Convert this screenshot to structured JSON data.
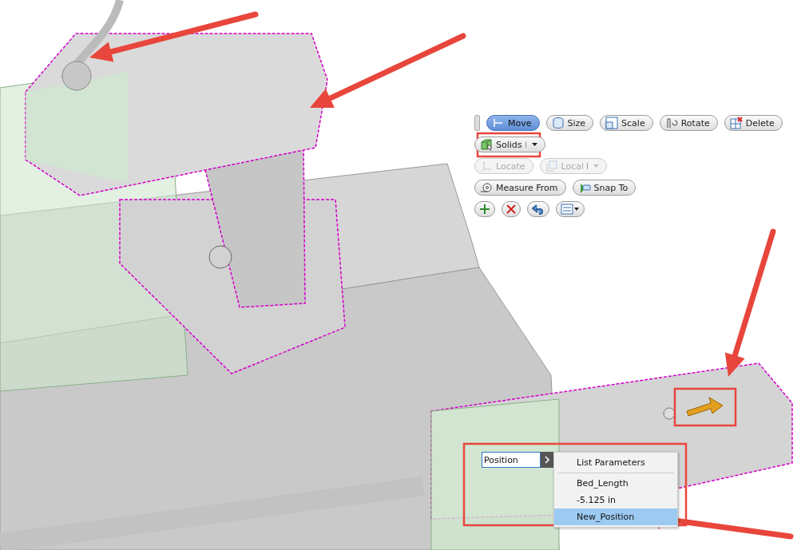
{
  "toolbar": {
    "rows": [
      {
        "buttons": [
          {
            "label": "Move",
            "selected": true,
            "disabled": false
          },
          {
            "label": "Size",
            "selected": false,
            "disabled": false
          },
          {
            "label": "Scale",
            "selected": false,
            "disabled": false
          },
          {
            "label": "Rotate",
            "selected": false,
            "disabled": false
          },
          {
            "label": "Delete",
            "selected": false,
            "disabled": false
          }
        ]
      },
      {
        "buttons": [
          {
            "label": "Solids",
            "selected": false,
            "disabled": false
          }
        ]
      },
      {
        "buttons": [
          {
            "label": "Locate",
            "selected": false,
            "disabled": true
          },
          {
            "label": "Local",
            "selected": false,
            "disabled": true
          }
        ]
      },
      {
        "buttons": [
          {
            "label": "Measure From",
            "selected": false,
            "disabled": false
          },
          {
            "label": "Snap To",
            "selected": false,
            "disabled": false
          }
        ]
      }
    ]
  },
  "value_input": {
    "value": "Position"
  },
  "parameter_menu": {
    "items": [
      {
        "label": "List Parameters",
        "selected": false
      },
      {
        "label": "Bed_Length",
        "selected": false
      },
      {
        "label": "-5.125 in",
        "selected": false
      },
      {
        "label": "New_Position",
        "selected": true
      }
    ]
  }
}
